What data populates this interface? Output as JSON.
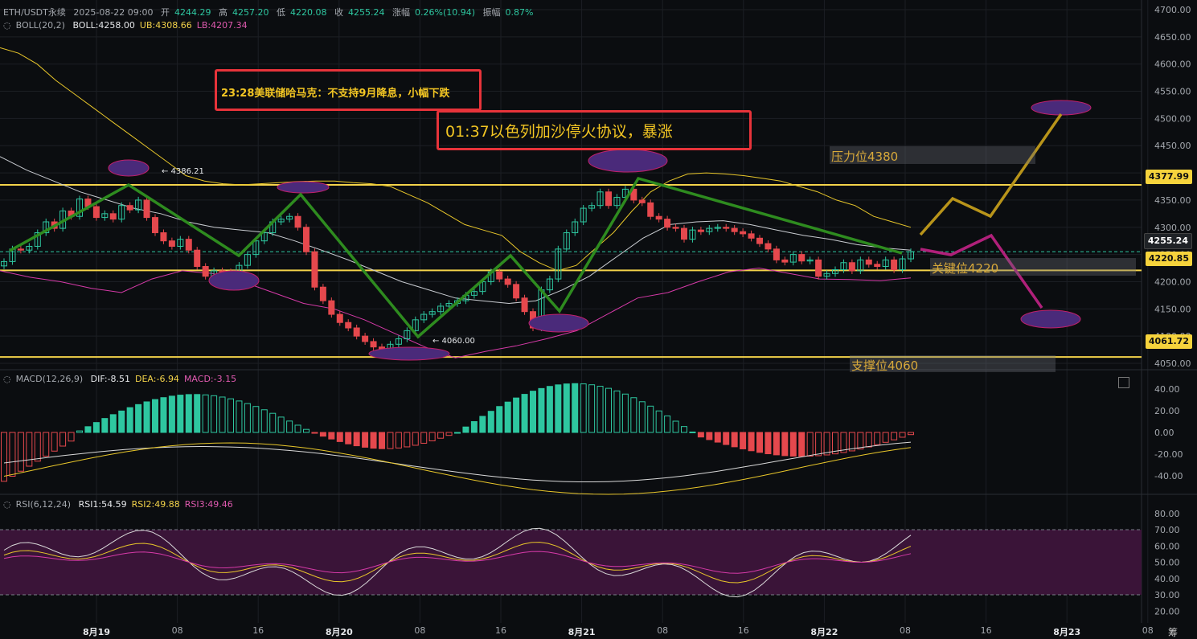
{
  "header": {
    "symbol": "ETH/USDT永续",
    "datetime": "2025-08-22 09:00",
    "open_label": "开",
    "open": "4244.29",
    "high_label": "高",
    "high": "4257.20",
    "low_label": "低",
    "low": "4220.08",
    "close_label": "收",
    "close": "4255.24",
    "change_label": "涨幅",
    "change": "0.26%(10.94)",
    "amp_label": "振幅",
    "amp": "0.87%"
  },
  "boll": {
    "name": "BOLL(20,2)",
    "mid": "BOLL:4258.00",
    "ub": "UB:4308.66",
    "lb": "LB:4207.34"
  },
  "macd": {
    "name": "MACD(12,26,9)",
    "dif": "DIF:-8.51",
    "dea": "DEA:-6.94",
    "macd": "MACD:-3.15"
  },
  "rsi": {
    "name": "RSI(6,12,24)",
    "rsi1": "RSI1:54.59",
    "rsi2": "RSI2:49.88",
    "rsi3": "RSI3:49.46"
  },
  "annotations": {
    "note1": "23:28美联储哈马克：不支持9月降息，小幅下跌",
    "note2": "01:37以色列加沙停火协议，暴涨",
    "resistance": "压力位4380",
    "key": "关键位4220",
    "support": "支撑位4060",
    "high_mark": "← 4386.21",
    "low_mark": "← 4060.00"
  },
  "price_levels": {
    "resistance": "4377.99",
    "current": "4255.24",
    "key": "4220.85",
    "support": "4061.72"
  },
  "colors": {
    "up": "#2ec7a0",
    "down": "#e5484d",
    "level": "#f3d34a",
    "trend": "#2e8b1f",
    "bull_path": "#b8941a",
    "bear_path": "#b0207a",
    "ellipse": "#4a2a7a"
  },
  "chart_data": [
    {
      "type": "candlestick",
      "title": "ETH/USDT永续",
      "y_ticks": [
        "4700.00",
        "4650.00",
        "4600.00",
        "4550.00",
        "4500.00",
        "4450.00",
        "4400.00",
        "4350.00",
        "4300.00",
        "4250.00",
        "4200.00",
        "4150.00",
        "4100.00",
        "4050.00"
      ],
      "ylim": [
        4040,
        4705
      ],
      "x_ticks": [
        "8月19",
        "08",
        "16",
        "8月20",
        "08",
        "16",
        "8月21",
        "08",
        "16",
        "8月22",
        "08",
        "16",
        "8月23",
        "08"
      ],
      "close": [
        4237,
        4260,
        4258,
        4265,
        4290,
        4310,
        4298,
        4330,
        4320,
        4352,
        4338,
        4318,
        4325,
        4315,
        4340,
        4332,
        4350,
        4318,
        4290,
        4275,
        4265,
        4278,
        4258,
        4228,
        4210,
        4220,
        4218,
        4215,
        4230,
        4250,
        4275,
        4290,
        4310,
        4315,
        4320,
        4300,
        4255,
        4190,
        4165,
        4140,
        4125,
        4115,
        4100,
        4090,
        4080,
        4068,
        4085,
        4095,
        4110,
        4130,
        4140,
        4145,
        4155,
        4160,
        4165,
        4175,
        4182,
        4200,
        4218,
        4205,
        4195,
        4170,
        4145,
        4115,
        4185,
        4205,
        4260,
        4290,
        4310,
        4335,
        4340,
        4365,
        4340,
        4355,
        4370,
        4350,
        4345,
        4320,
        4315,
        4300,
        4298,
        4278,
        4295,
        4292,
        4298,
        4300,
        4298,
        4292,
        4288,
        4280,
        4270,
        4260,
        4240,
        4236,
        4250,
        4238,
        4240,
        4210,
        4215,
        4222,
        4235,
        4220,
        4240,
        4232,
        4228,
        4240,
        4222,
        4242,
        4255
      ],
      "boll_ub": [
        4630,
        4620,
        4600,
        4570,
        4545,
        4520,
        4495,
        4470,
        4445,
        4420,
        4395,
        4385,
        4380,
        4378,
        4380,
        4382,
        4384,
        4385,
        4385,
        4382,
        4380,
        4375,
        4360,
        4345,
        4325,
        4305,
        4295,
        4285,
        4255,
        4235,
        4220,
        4230,
        4260,
        4290,
        4330,
        4365,
        4385,
        4398,
        4400,
        4398,
        4395,
        4390,
        4385,
        4375,
        4365,
        4350,
        4340,
        4320,
        4310,
        4300
      ],
      "boll_mid": [
        4430,
        4405,
        4385,
        4365,
        4350,
        4335,
        4325,
        4310,
        4300,
        4295,
        4290,
        4275,
        4258,
        4240,
        4220,
        4200,
        4185,
        4170,
        4165,
        4160,
        4165,
        4185,
        4210,
        4245,
        4280,
        4305,
        4310,
        4312,
        4305,
        4295,
        4285,
        4278,
        4268,
        4262,
        4258
      ],
      "boll_lb": [
        4220,
        4208,
        4200,
        4188,
        4180,
        4205,
        4220,
        4215,
        4200,
        4180,
        4160,
        4150,
        4130,
        4105,
        4080,
        4060,
        4072,
        4082,
        4095,
        4110,
        4140,
        4170,
        4180,
        4200,
        4218,
        4225,
        4215,
        4205,
        4204,
        4202,
        4207
      ],
      "macd_hist_sign_changes": "negative→positive→negative→positive→negative",
      "macd_ticks": [
        "40.00",
        "20.00",
        "0.00",
        "-20.00",
        "-40.00"
      ],
      "rsi_ticks": [
        "80.00",
        "70.00",
        "60.00",
        "50.00",
        "40.00",
        "30.00",
        "20.00"
      ],
      "rsi_bands": [
        70,
        30
      ]
    }
  ]
}
